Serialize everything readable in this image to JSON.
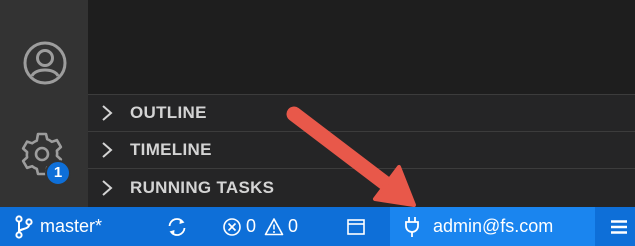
{
  "activity_bar": {
    "settings_badge_count": "1"
  },
  "sidebar": {
    "sections": [
      {
        "label": "OUTLINE"
      },
      {
        "label": "TIMELINE"
      },
      {
        "label": "RUNNING TASKS"
      }
    ]
  },
  "status_bar": {
    "branch": "master*",
    "errors": "0",
    "warnings": "0",
    "remote_host": "admin@fs.com",
    "background_color": "#0e6fd8",
    "remote_item_color": "#1a85ef"
  },
  "annotation": {
    "arrow_color": "#e8584a"
  }
}
